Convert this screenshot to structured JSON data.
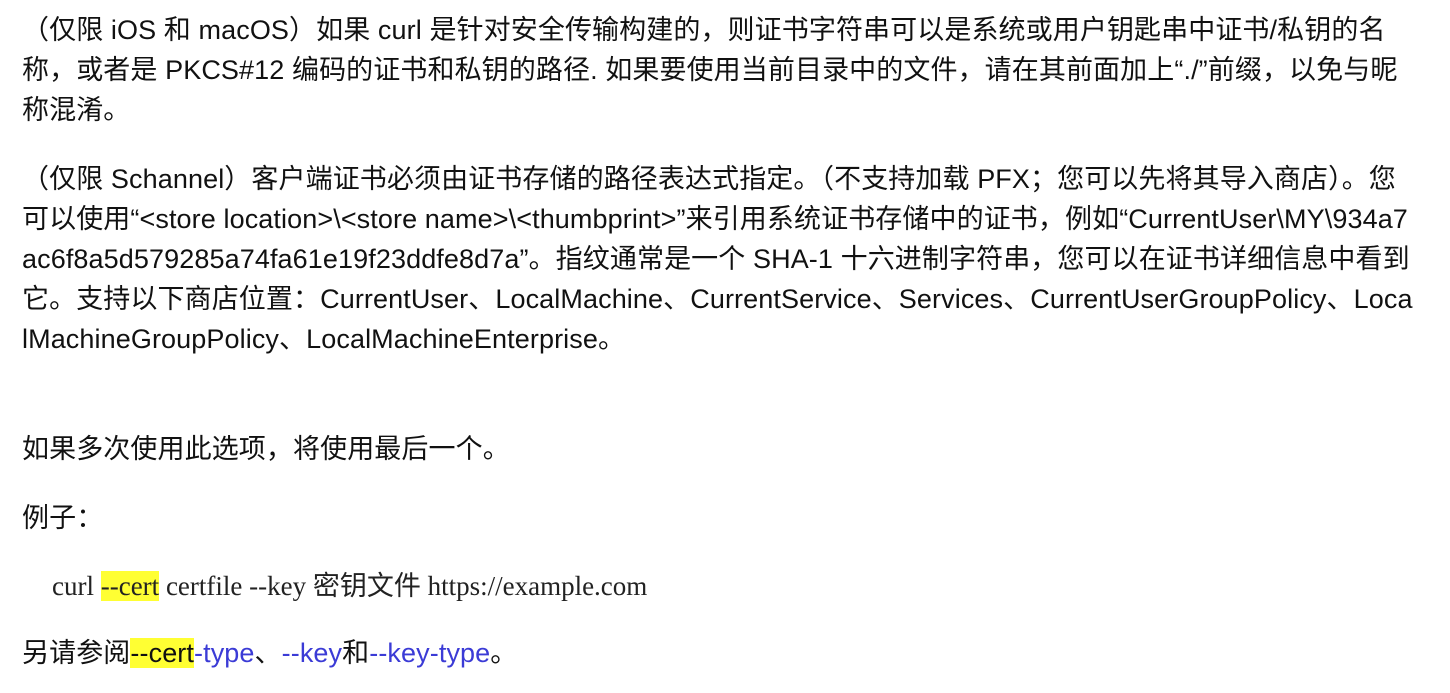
{
  "paragraphs": {
    "p1": "（仅限 iOS 和 macOS）如果 curl 是针对安全传输构建的，则证书字符串可以是系统或用户钥匙串中证书/私钥的名称，或者是 PKCS#12 编码的证书和私钥的路径. 如果要使用当前目录中的文件，请在其前面加上“./”前缀，以免与昵称混淆。",
    "p2": "（仅限 Schannel）客户端证书必须由证书存储的路径表达式指定。（不支持加载 PFX；您可以先将其导入商店）。您可以使用“<store location>\\<store name>\\<thumbprint>”来引用系统证书存储中的证书，例如“CurrentUser\\MY\\934a7ac6f8a5d579285a74fa61e19f23ddfe8d7a”。指纹通常是一个 SHA-1 十六进制字符串，您可以在证书详细信息中看到它。支持以下商店位置：CurrentUser、LocalMachine、CurrentService、Services、CurrentUserGroupPolicy、LocalMachineGroupPolicy、LocalMachineEnterprise。",
    "p3": "如果多次使用此选项，将使用最后一个。",
    "p4": "例子："
  },
  "example": {
    "prefix": "curl ",
    "highlighted": "--cert",
    "suffix": " certfile --key 密钥文件 https://example.com"
  },
  "see_also": {
    "prefix": "另请参阅",
    "link1_highlight": "--cert",
    "link1_rest": "-type",
    "sep1": "、",
    "link2": "--key",
    "sep2": "和",
    "link3": "--key-type",
    "end": "。"
  },
  "colors": {
    "highlight": "#ffff33",
    "link": "#3b3bd6",
    "text": "#111111"
  }
}
